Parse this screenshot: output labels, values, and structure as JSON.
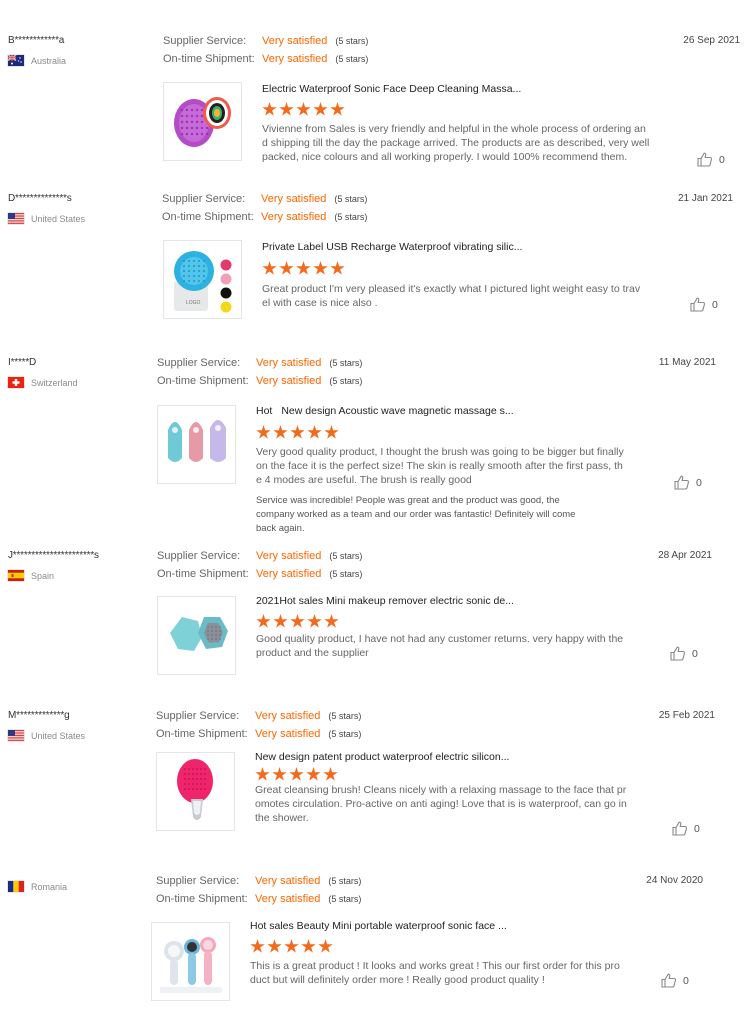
{
  "labels": {
    "supplier_service": "Supplier Service:",
    "ontime_shipment": "On-time Shipment:"
  },
  "colors": {
    "accent": "#ff6600",
    "star": "#f26b1d"
  },
  "reviews": [
    {
      "user": "B************a",
      "country": "Australia",
      "flag": "au",
      "supplier_service": "Very satisfied",
      "supplier_stars": "(5 stars)",
      "shipment": "Very satisfied",
      "shipment_stars": "(5 stars)",
      "date": "26 Sep 2021",
      "product_title": "Electric Waterproof Sonic Face Deep Cleaning Massa...",
      "rating": 5,
      "text": "Vivienne from Sales is very friendly and helpful in the whole process of ordering and shipping till the day the package arrived. The products are as described, very well packed, nice colours and all working properly. I would 100% recommend them.",
      "helpful_count": "0",
      "image": "purple-brush"
    },
    {
      "user": "D**************s",
      "country": "United States",
      "flag": "us",
      "supplier_service": "Very satisfied",
      "supplier_stars": "(5 stars)",
      "shipment": "Very satisfied",
      "shipment_stars": "(5 stars)",
      "date": "21 Jan 2021",
      "product_title": "Private Label USB Recharge Waterproof vibrating silic...",
      "rating": 5,
      "text": "Great product I'm very pleased it's exactly what I pictured light weight easy to travel with case is nice also .",
      "helpful_count": "0",
      "image": "blue-brush-logo"
    },
    {
      "user": "I*****D",
      "country": "Switzerland",
      "flag": "ch",
      "supplier_service": "Very satisfied",
      "supplier_stars": "(5 stars)",
      "shipment": "Very satisfied",
      "shipment_stars": "(5 stars)",
      "date": "11 May 2021",
      "product_hot": "Hot",
      "product_title": "New design Acoustic wave magnetic massage s...",
      "rating": 5,
      "text": "Very good quality product, I thought the brush was going to be bigger but finally on the face it is the perfect size! The skin is really smooth after the first pass, the 4 modes are useful. The brush is really good",
      "supplier_reply": "Service was incredible! People was great and the product was good, the company worked as a team and our order was fantastic! Definitely will come back again.",
      "helpful_count": "0",
      "image": "three-brushes"
    },
    {
      "user": "J**********************s",
      "country": "Spain",
      "flag": "es",
      "supplier_service": "Very satisfied",
      "supplier_stars": "(5 stars)",
      "shipment": "Very satisfied",
      "shipment_stars": "(5 stars)",
      "date": "28 Apr 2021",
      "product_title": "2021Hot sales Mini makeup remover electric sonic de...",
      "rating": 5,
      "text": "Good quality product, I have not had any customer returns. very happy with the product and the supplier",
      "helpful_count": "0",
      "image": "hex-brush"
    },
    {
      "user": "M*************g",
      "country": "United States",
      "flag": "us",
      "supplier_service": "Very satisfied",
      "supplier_stars": "(5 stars)",
      "shipment": "Very satisfied",
      "shipment_stars": "(5 stars)",
      "date": "25 Feb 2021",
      "product_title": "New design patent product waterproof electric silicon...",
      "rating": 5,
      "text": "Great cleansing brush! Cleans nicely with a relaxing massage to the face that promotes circulation. Pro-active on anti aging! Love that is is waterproof, can go in the shower.",
      "helpful_count": "0",
      "image": "pink-brush"
    },
    {
      "user": "",
      "country": "Romania",
      "flag": "ro",
      "supplier_service": "Very satisfied",
      "supplier_stars": "(5 stars)",
      "shipment": "Very satisfied",
      "shipment_stars": "(5 stars)",
      "date": "24 Nov 2020",
      "product_title": "Hot sales Beauty Mini portable waterproof sonic face ...",
      "rating": 5,
      "text": "This is a great product ! It looks and works great ! This our first order for this product but will definitely order more ! Really good product quality !",
      "helpful_count": "0",
      "image": "spin-brushes"
    }
  ]
}
